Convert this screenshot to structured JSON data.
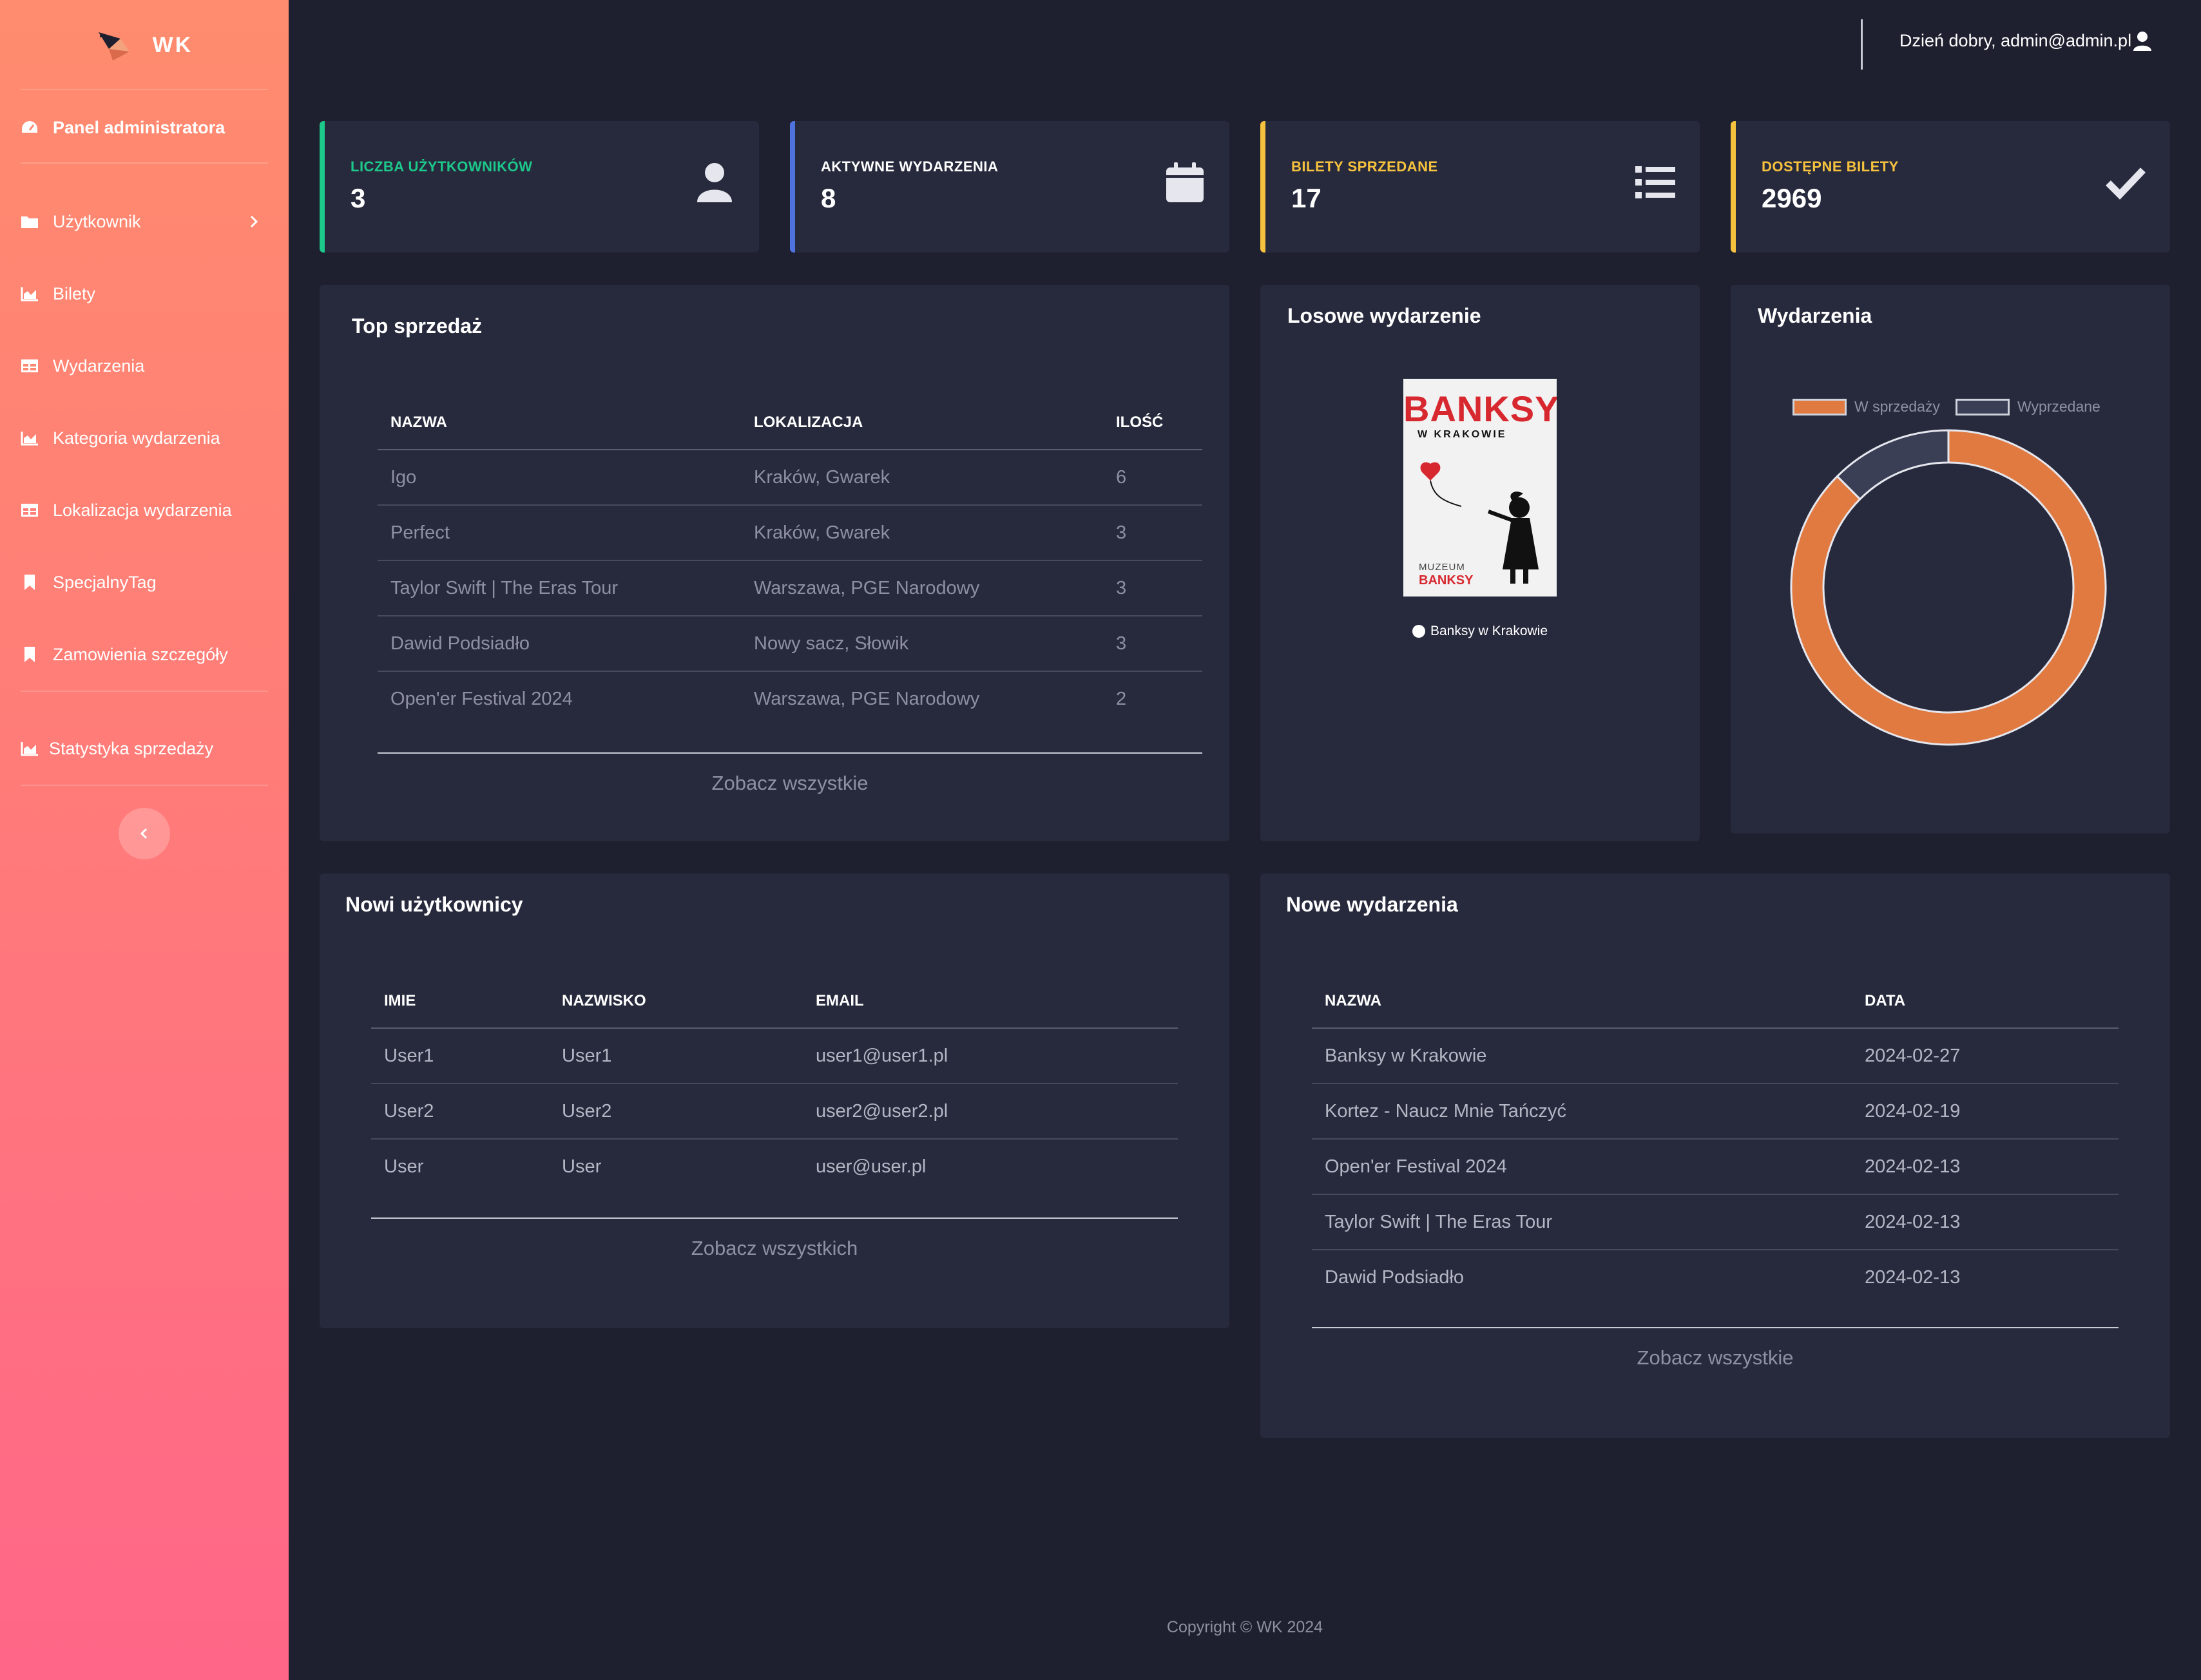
{
  "brand": {
    "name": "WK"
  },
  "sidebar": {
    "items": [
      {
        "label": "Panel administratora",
        "icon": "dashboard-icon"
      },
      {
        "label": "Użytkownik",
        "icon": "folder-icon"
      },
      {
        "label": "Bilety",
        "icon": "area-chart-icon"
      },
      {
        "label": "Wydarzenia",
        "icon": "table-icon"
      },
      {
        "label": "Kategoria wydarzenia",
        "icon": "area-chart-icon"
      },
      {
        "label": "Lokalizacja wydarzenia",
        "icon": "table-icon"
      },
      {
        "label": "SpecjalnyTag",
        "icon": "bookmark-icon"
      },
      {
        "label": "Zamowienia szczegóły",
        "icon": "bookmark-icon"
      },
      {
        "label": "Statystyka sprzedaży",
        "icon": "area-chart-icon"
      }
    ]
  },
  "topbar": {
    "greeting": "Dzień dobry, admin@admin.pl"
  },
  "stats": [
    {
      "label": "LICZBA UŻYTKOWNIKÓW",
      "value": "3",
      "color": "#1cc88a",
      "icon": "user-icon"
    },
    {
      "label": "AKTYWNE WYDARZENIA",
      "value": "8",
      "color": "#4e73df",
      "icon": "calendar-icon"
    },
    {
      "label": "BILETY SPRZEDANE",
      "value": "17",
      "color": "#f6c23e",
      "icon": "list-icon"
    },
    {
      "label": "DOSTĘPNE BILETY",
      "value": "2969",
      "color": "#f6c23e",
      "icon": "check-icon"
    }
  ],
  "top_sales": {
    "title": "Top sprzedaż",
    "headers": [
      "NAZWA",
      "LOKALIZACJA",
      "ILOŚĆ"
    ],
    "rows": [
      [
        "Igo",
        "Kraków, Gwarek",
        "6"
      ],
      [
        "Perfect",
        "Kraków, Gwarek",
        "3"
      ],
      [
        "Taylor Swift | The Eras Tour",
        "Warszawa, PGE Narodowy",
        "3"
      ],
      [
        "Dawid Podsiadło",
        "Nowy sacz, Słowik",
        "3"
      ],
      [
        "Open'er Festival 2024",
        "Warszawa, PGE Narodowy",
        "2"
      ]
    ],
    "see_all": "Zobacz wszystkie"
  },
  "random_event": {
    "title": "Losowe wydarzenie",
    "poster": {
      "title": "BANKSY",
      "subtitle": "W KRAKOWIE",
      "footer_top": "MUZEUM",
      "footer_bottom": "BANKSY"
    },
    "caption": "Banksy w Krakowie"
  },
  "events_chart": {
    "title": "Wydarzenia",
    "chart_data": {
      "type": "pie",
      "title": "Wydarzenia",
      "categories": [
        "W sprzedaży",
        "Wyprzedane"
      ],
      "values": [
        7,
        1
      ],
      "colors": [
        "#e07a40",
        "#3a3f56"
      ],
      "legend": "top"
    }
  },
  "new_users": {
    "title": "Nowi użytkownicy",
    "headers": [
      "IMIE",
      "NAZWISKO",
      "EMAIL"
    ],
    "rows": [
      [
        "User1",
        "User1",
        "user1@user1.pl"
      ],
      [
        "User2",
        "User2",
        "user2@user2.pl"
      ],
      [
        "User",
        "User",
        "user@user.pl"
      ]
    ],
    "see_all": "Zobacz wszystkich"
  },
  "new_events": {
    "title": "Nowe wydarzenia",
    "headers": [
      "NAZWA",
      "DATA"
    ],
    "rows": [
      [
        "Banksy w Krakowie",
        "2024-02-27"
      ],
      [
        "Kortez - Naucz Mnie Tańczyć",
        "2024-02-19"
      ],
      [
        "Open'er Festival 2024",
        "2024-02-13"
      ],
      [
        "Taylor Swift | The Eras Tour",
        "2024-02-13"
      ],
      [
        "Dawid Podsiadło",
        "2024-02-13"
      ]
    ],
    "see_all": "Zobacz wszystkie"
  },
  "footer": {
    "copyright": "Copyright © WK 2024"
  }
}
